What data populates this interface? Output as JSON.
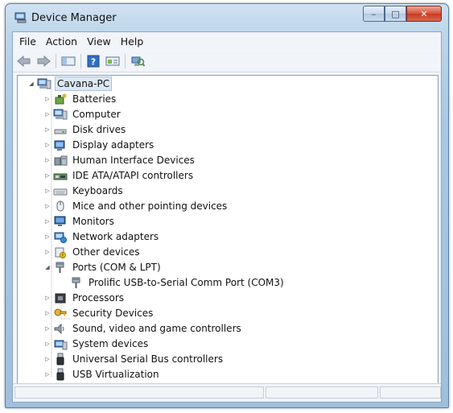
{
  "window": {
    "title": "Device Manager",
    "controls": {
      "minimize": "–",
      "maximize": "□",
      "close": "✕"
    }
  },
  "menu": [
    {
      "label": "File"
    },
    {
      "label": "Action"
    },
    {
      "label": "View"
    },
    {
      "label": "Help"
    }
  ],
  "toolbar": [
    {
      "name": "back-icon",
      "glyph": "⇦"
    },
    {
      "name": "forward-icon",
      "glyph": "⇨"
    },
    {
      "name": "show-hide-console-tree-icon",
      "glyph": "▭"
    },
    {
      "name": "help-icon",
      "glyph": "?"
    },
    {
      "name": "properties-icon",
      "glyph": "▤"
    },
    {
      "name": "scan-hardware-icon",
      "glyph": "⟳"
    }
  ],
  "tree": {
    "root": {
      "label": "Cavana-PC",
      "icon": "computer-icon",
      "expanded": true
    },
    "items": [
      {
        "label": "Batteries",
        "icon": "battery-icon",
        "expanded": false
      },
      {
        "label": "Computer",
        "icon": "computer-icon",
        "expanded": false
      },
      {
        "label": "Disk drives",
        "icon": "disk-drive-icon",
        "expanded": false
      },
      {
        "label": "Display adapters",
        "icon": "display-adapter-icon",
        "expanded": false
      },
      {
        "label": "Human Interface Devices",
        "icon": "hid-icon",
        "expanded": false
      },
      {
        "label": "IDE ATA/ATAPI controllers",
        "icon": "ide-controller-icon",
        "expanded": false
      },
      {
        "label": "Keyboards",
        "icon": "keyboard-icon",
        "expanded": false
      },
      {
        "label": "Mice and other pointing devices",
        "icon": "mouse-icon",
        "expanded": false
      },
      {
        "label": "Monitors",
        "icon": "monitor-icon",
        "expanded": false
      },
      {
        "label": "Network adapters",
        "icon": "network-adapter-icon",
        "expanded": false
      },
      {
        "label": "Other devices",
        "icon": "other-device-icon",
        "expanded": false
      },
      {
        "label": "Ports (COM & LPT)",
        "icon": "port-icon",
        "expanded": true,
        "children": [
          {
            "label": "Prolific USB-to-Serial Comm Port (COM3)",
            "icon": "port-icon"
          }
        ]
      },
      {
        "label": "Processors",
        "icon": "processor-icon",
        "expanded": false
      },
      {
        "label": "Security Devices",
        "icon": "security-device-icon",
        "expanded": false
      },
      {
        "label": "Sound, video and game controllers",
        "icon": "sound-icon",
        "expanded": false
      },
      {
        "label": "System devices",
        "icon": "system-device-icon",
        "expanded": false
      },
      {
        "label": "Universal Serial Bus controllers",
        "icon": "usb-icon",
        "expanded": false
      },
      {
        "label": "USB Virtualization",
        "icon": "usb-icon",
        "expanded": false
      }
    ]
  },
  "colors": {
    "title_bar": "#a9c8e3",
    "close_button": "#c63a22",
    "selection": "#dde8f4"
  }
}
